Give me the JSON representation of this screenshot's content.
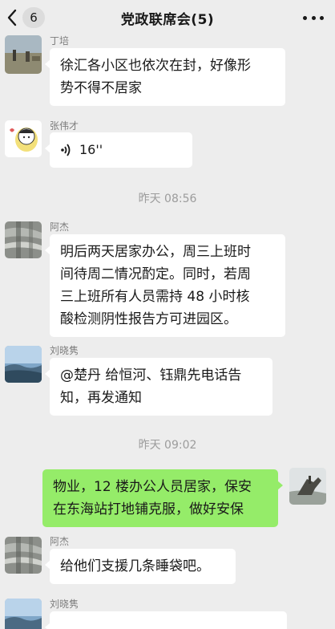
{
  "header": {
    "back_count": "6",
    "title": "党政联席会(5)"
  },
  "messages": [
    {
      "sender": "丁培",
      "text": "徐汇各小区也依次在封，好像形势不得不居家",
      "lines": [
        "徐汇各小区也依次在封，好像形",
        "势不得不居家"
      ]
    },
    {
      "sender": "张伟才",
      "voice_duration": "16''"
    },
    {
      "timestamp": "昨天 08:56"
    },
    {
      "sender": "阿杰",
      "lines": [
        "明后两天居家办公，周三上班时",
        "间待周二情况酌定。同时，若周",
        "三上班所有人员需持 48 小时核",
        "酸检测阴性报告方可进园区。"
      ]
    },
    {
      "sender": "刘晓隽",
      "lines": [
        "@楚丹 给恒河、钰鼎先电话告",
        "知，再发通知"
      ]
    },
    {
      "timestamp": "昨天 09:02"
    },
    {
      "self": true,
      "lines": [
        "物业，12 楼办公人员居家，保安",
        "在东海站打地铺克服，做好安保"
      ]
    },
    {
      "sender": "阿杰",
      "lines": [
        "给他们支援几条睡袋吧。"
      ]
    },
    {
      "sender": "刘晓隽"
    }
  ],
  "colors": {
    "background": "#ededed",
    "incoming_bubble": "#ffffff",
    "outgoing_bubble": "#95ec69"
  },
  "icons": [
    "back-chevron-icon",
    "more-dots-icon",
    "voice-wave-icon"
  ]
}
